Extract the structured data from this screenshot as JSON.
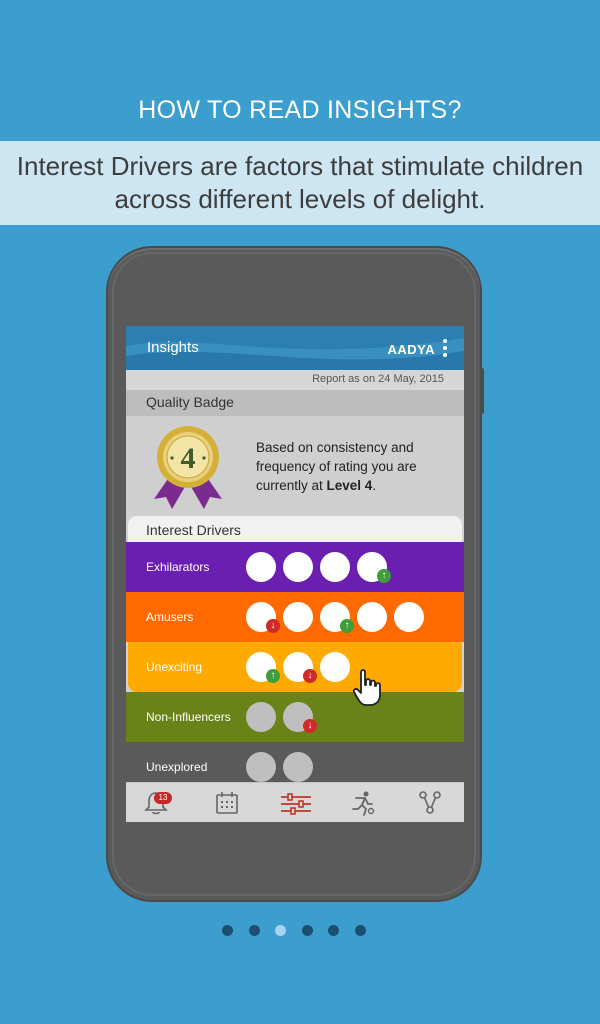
{
  "headline": "HOW TO READ INSIGHTS?",
  "subtitle": "Interest Drivers are factors that stimulate children across different levels of delight.",
  "app": {
    "title": "Insights",
    "brand": "AADYA",
    "report_date": "Report as on 24 May, 2015"
  },
  "quality_badge": {
    "header": "Quality Badge",
    "level_number": "4",
    "text_prefix": "Based on consistency and frequency of rating you are currently at ",
    "text_level": "Level 4",
    "text_suffix": "."
  },
  "interest_drivers": {
    "header": "Interest Drivers",
    "rows": [
      {
        "label": "Exhilarators",
        "color": "#6b1fb1",
        "count": 4,
        "arrows": [
          "none",
          "none",
          "none",
          "up"
        ]
      },
      {
        "label": "Amusers",
        "color": "#ff6a00",
        "count": 5,
        "arrows": [
          "down",
          "none",
          "up",
          "none",
          "none"
        ]
      },
      {
        "label": "Unexciting",
        "color": "#ffaa00",
        "count": 3,
        "arrows": [
          "up",
          "down",
          "none"
        ]
      },
      {
        "label": "Non-Influencers",
        "color": "#6a8319",
        "count": 2,
        "arrows": [
          "none",
          "down"
        ]
      },
      {
        "label": "Unexplored",
        "color": "#5a5a5a",
        "count": 2,
        "arrows": [
          "none",
          "none"
        ]
      }
    ]
  },
  "tabbar": {
    "notifications_count": "13",
    "active_tab": "insights",
    "active_color": "#c0392b"
  },
  "pager": {
    "total": 6,
    "active_index": 2
  },
  "colors": {
    "background": "#3c9ecf",
    "appbar": "#2d7fb3",
    "badge_gold": "#d4b03a",
    "badge_ribbon": "#7b2a8e"
  }
}
